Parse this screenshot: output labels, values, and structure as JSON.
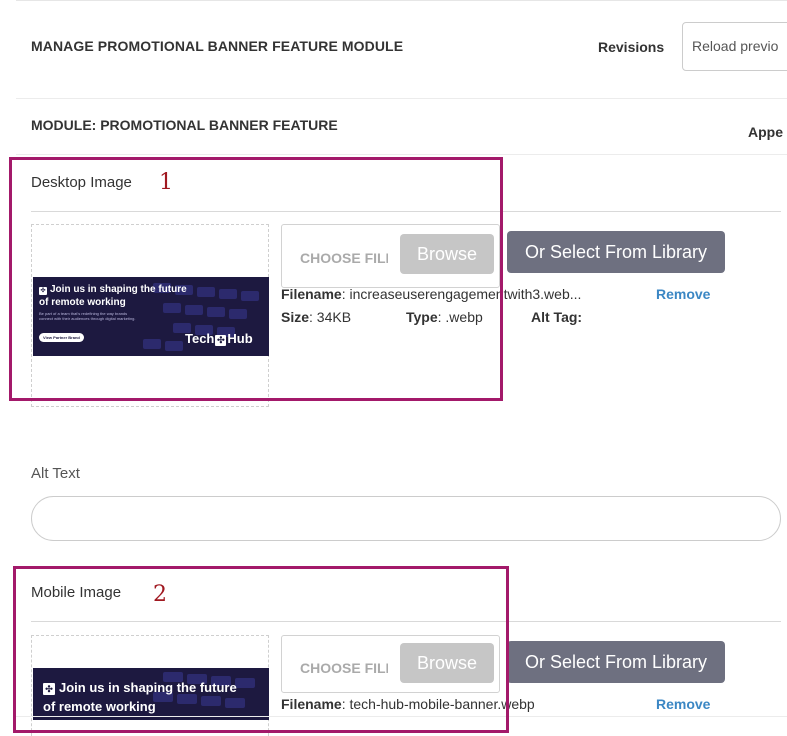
{
  "header": {
    "title": "MANAGE PROMOTIONAL BANNER FEATURE MODULE",
    "revisions_label": "Revisions",
    "revisions_select_value": "Reload previo"
  },
  "module": {
    "title": "MODULE: PROMOTIONAL BANNER FEATURE",
    "appearance_label": "Appe"
  },
  "desktop": {
    "label": "Desktop Image",
    "annotation_number": "1",
    "choose_file": "CHOOSE FILE",
    "browse_label": "Browse",
    "library_label": "Or Select From Library",
    "filename_label": "Filename",
    "filename_value": "increaseuserengagementwith3.web...",
    "remove_label": "Remove",
    "size_label": "Size",
    "size_value": "34KB",
    "type_label": "Type",
    "type_value": ".webp",
    "alt_tag_label": "Alt Tag:",
    "banner": {
      "headline_line1": "Join us in shaping the future",
      "headline_line2": "of remote working",
      "subtext": "Be part of a team that's redefining the way brands connect with their audiences through digital marketing.",
      "cta": "View Partner Brand",
      "brand_left": "Tech",
      "brand_right": "Hub"
    }
  },
  "alt_text": {
    "label": "Alt Text",
    "value": ""
  },
  "mobile": {
    "label": "Mobile Image",
    "annotation_number": "2",
    "choose_file": "CHOOSE FILE",
    "browse_label": "Browse",
    "library_label": "Or Select From Library",
    "filename_label": "Filename",
    "filename_value": "tech-hub-mobile-banner.webp",
    "remove_label": "Remove",
    "banner": {
      "headline_line1": "Join us in shaping the future",
      "headline_line2": "of remote working"
    }
  },
  "colors": {
    "highlight": "#a3196a",
    "annotation_number": "#a01820",
    "library_button": "#6e7080",
    "browse_button": "#c6c6c6",
    "link": "#3b87c4",
    "banner_bg": "#1d1940"
  }
}
